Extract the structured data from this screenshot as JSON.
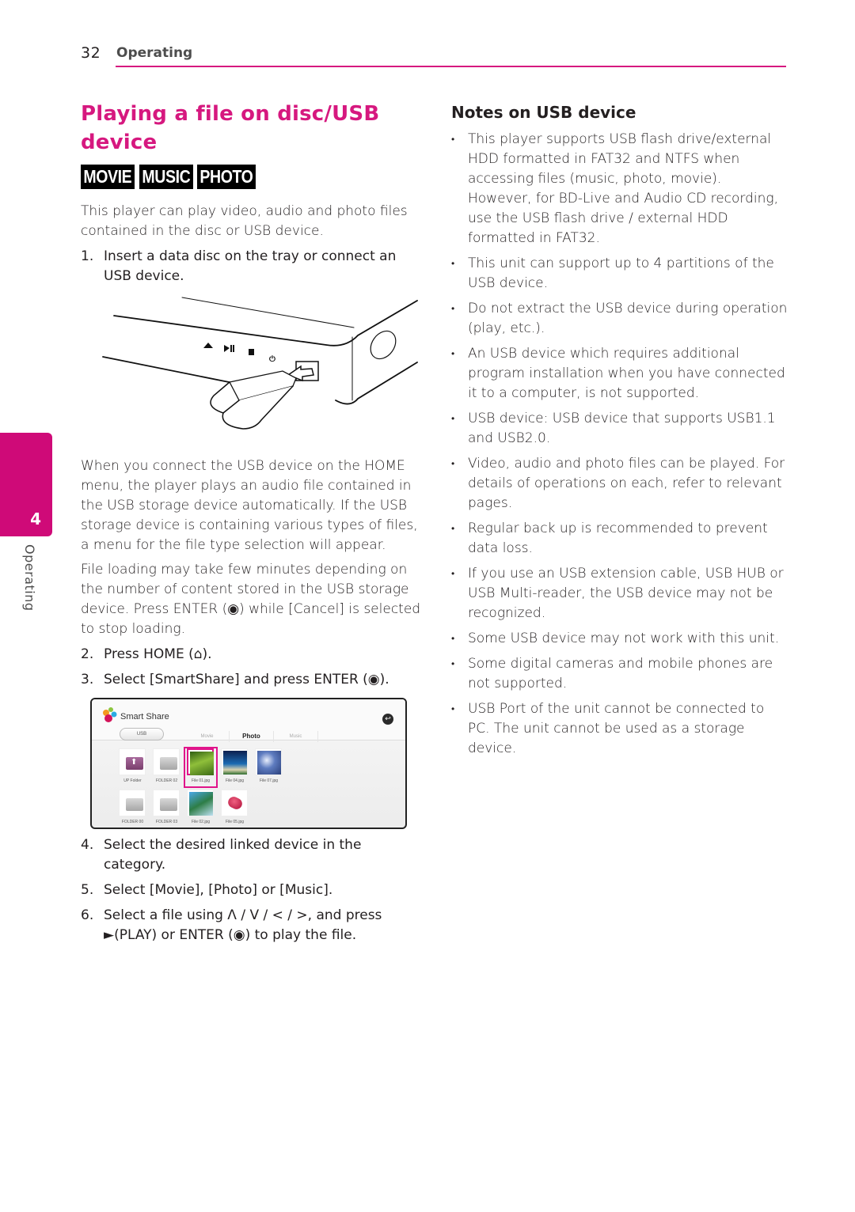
{
  "header": {
    "page_number": "32",
    "section": "Operating"
  },
  "side_tab": {
    "chapter_number": "4",
    "chapter_label": "Operating"
  },
  "colors": {
    "accent": "#d6187f",
    "side_tab": "#cf0a78",
    "text": "#231f20"
  },
  "left": {
    "title": "Playing a file on disc/USB device",
    "badges": [
      "MOVIE",
      "MUSIC",
      "PHOTO"
    ],
    "intro": "This player can play video, audio and photo files contained in the disc or USB device.",
    "step1": {
      "n": "1.",
      "text": "Insert a data disc on the tray or connect an USB device."
    },
    "illustration": {
      "description": "Player front panel with USB flash drive being inserted",
      "button_icons": [
        "eject-icon",
        "play-pause-icon",
        "stop-icon",
        "power-icon"
      ]
    },
    "para_auto": "When you connect the USB device on the HOME menu, the player plays an audio file contained in the USB storage device automatically. If the USB storage device is containing various types of files, a menu for the file type selection will appear.",
    "para_loading": "File loading may take few minutes depending on the number of content stored in the USB storage device. Press ENTER (◉) while [Cancel] is selected to stop loading.",
    "step2": {
      "n": "2.",
      "text": "Press HOME (⌂)."
    },
    "step3": {
      "n": "3.",
      "text": "Select [SmartShare] and press ENTER (◉)."
    },
    "smart_share": {
      "title": "Smart Share",
      "device": "USB",
      "tabs": [
        "Movie",
        "Photo",
        "Music"
      ],
      "active_tab": "Photo",
      "back_icon": "↩",
      "items": [
        {
          "label": "UP Folder",
          "kind": "up-folder"
        },
        {
          "label": "FOLDER 02",
          "kind": "folder"
        },
        {
          "label": "File 01.jpg",
          "kind": "forest",
          "selected": true
        },
        {
          "label": "File 04.jpg",
          "kind": "beach"
        },
        {
          "label": "File 07.jpg",
          "kind": "blue"
        },
        {
          "label": "FOLDER 00",
          "kind": "folder"
        },
        {
          "label": "FOLDER 03",
          "kind": "folder"
        },
        {
          "label": "File 02.jpg",
          "kind": "coast"
        },
        {
          "label": "File 05.jpg",
          "kind": "car"
        }
      ]
    },
    "step4": {
      "n": "4.",
      "text": "Select the desired linked device in the category."
    },
    "step5": {
      "n": "5.",
      "text": "Select [Movie], [Photo] or [Music]."
    },
    "step6": {
      "n": "6.",
      "text": "Select a file using Λ / V / < / >, and press ►(PLAY) or ENTER (◉) to play the file."
    }
  },
  "right": {
    "heading": "Notes on USB device",
    "bullet": "•",
    "notes": [
      "This player supports USB flash drive/external HDD formatted in FAT32 and NTFS when accessing files (music, photo, movie). However, for BD-Live and Audio CD recording, use the USB flash drive / external HDD formatted in FAT32.",
      "This unit can support up to 4 partitions of the USB device.",
      "Do not extract the USB device during operation (play, etc.).",
      "An USB device which requires additional program installation when you have connected it to a computer, is not supported.",
      "USB device: USB device that supports USB1.1 and USB2.0.",
      "Video, audio and photo files can be played. For details of operations on each, refer to relevant pages.",
      "Regular back up is recommended to prevent data loss.",
      "If you use an USB extension cable, USB HUB or USB Multi-reader, the USB device may not be recognized.",
      "Some USB device may not work with this unit.",
      "Some digital cameras and mobile phones are not supported.",
      "USB Port of the unit cannot be connected to PC. The unit cannot be used as a storage device."
    ]
  }
}
